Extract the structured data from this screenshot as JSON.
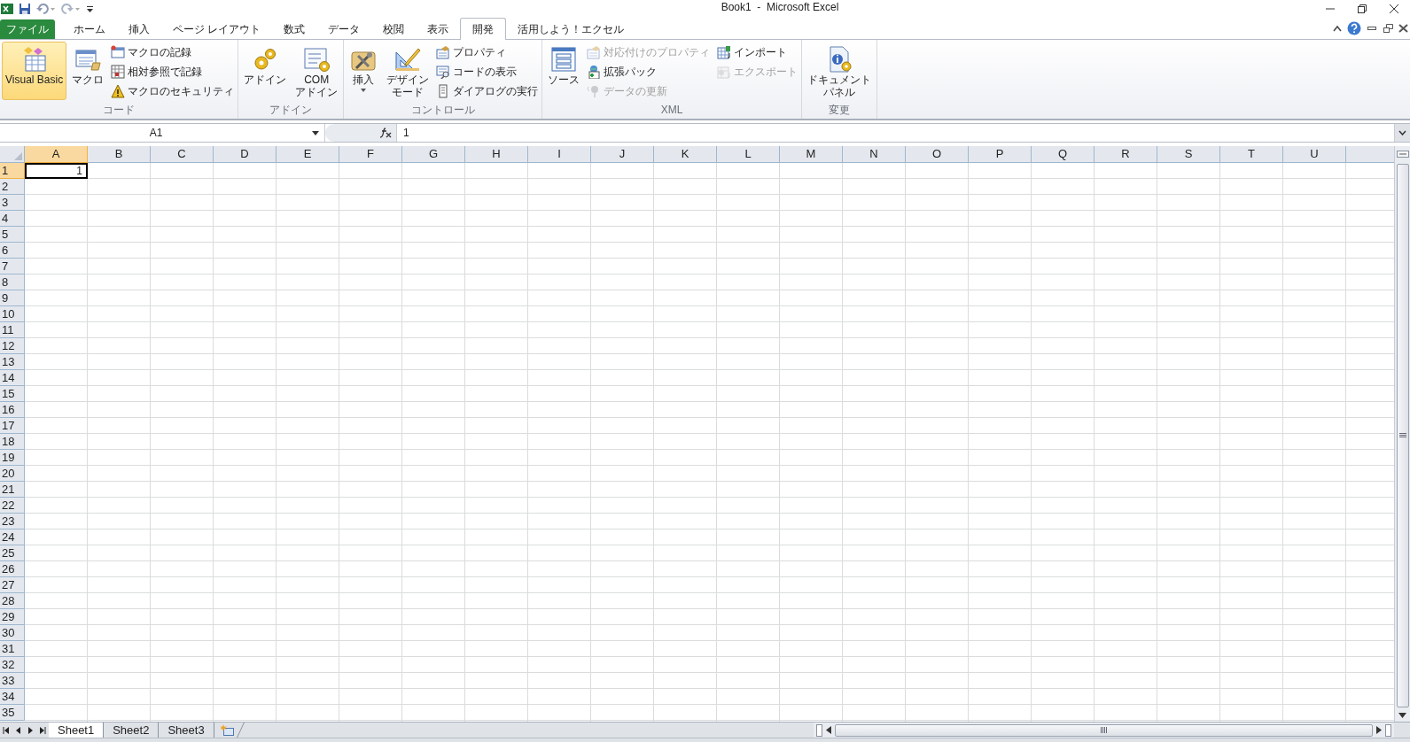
{
  "window": {
    "title": "Book1  -  Microsoft Excel"
  },
  "tabs": [
    {
      "label": "ファイル",
      "kind": "file",
      "selected": false
    },
    {
      "label": "ホーム",
      "kind": "tab",
      "selected": false
    },
    {
      "label": "挿入",
      "kind": "tab",
      "selected": false
    },
    {
      "label": "ページ レイアウト",
      "kind": "tab",
      "selected": false
    },
    {
      "label": "数式",
      "kind": "tab",
      "selected": false
    },
    {
      "label": "データ",
      "kind": "tab",
      "selected": false
    },
    {
      "label": "校閲",
      "kind": "tab",
      "selected": false
    },
    {
      "label": "表示",
      "kind": "tab",
      "selected": false
    },
    {
      "label": "開発",
      "kind": "tab",
      "selected": true
    },
    {
      "label": "活用しよう！エクセル",
      "kind": "tab",
      "selected": false
    }
  ],
  "ribbon": {
    "groups": [
      {
        "title": "コード",
        "large": [
          {
            "lines": [
              "Visual Basic"
            ],
            "highlighted": true
          },
          {
            "lines": [
              "マクロ"
            ],
            "highlighted": false
          }
        ],
        "small": [
          {
            "label": "マクロの記録",
            "disabled": false
          },
          {
            "label": "相対参照で記録",
            "disabled": false
          },
          {
            "label": "マクロのセキュリティ",
            "disabled": false
          }
        ]
      },
      {
        "title": "アドイン",
        "large": [
          {
            "lines": [
              "アドイン"
            ],
            "highlighted": false
          },
          {
            "lines": [
              "COM",
              "アドイン"
            ],
            "highlighted": false
          }
        ]
      },
      {
        "title": "コントロール",
        "large": [
          {
            "lines": [
              "挿入"
            ],
            "highlighted": false,
            "dropdown": true
          },
          {
            "lines": [
              "デザイン",
              "モード"
            ],
            "highlighted": false
          }
        ],
        "small": [
          {
            "label": "プロパティ",
            "disabled": false
          },
          {
            "label": "コードの表示",
            "disabled": false
          },
          {
            "label": "ダイアログの実行",
            "disabled": false
          }
        ]
      },
      {
        "title": "XML",
        "large": [
          {
            "lines": [
              "ソース"
            ],
            "highlighted": false
          }
        ],
        "small": [
          {
            "label": "対応付けのプロパティ",
            "disabled": true
          },
          {
            "label": "拡張パック",
            "disabled": false
          },
          {
            "label": "データの更新",
            "disabled": true
          },
          {
            "label": "インポート",
            "disabled": false
          },
          {
            "label": "エクスポート",
            "disabled": true
          }
        ]
      },
      {
        "title": "変更",
        "large": [
          {
            "lines": [
              "ドキュメント",
              "パネル"
            ],
            "highlighted": false
          }
        ]
      }
    ]
  },
  "formula_bar": {
    "name_box": "A1",
    "formula": "1"
  },
  "sheet": {
    "columns": [
      "A",
      "B",
      "C",
      "D",
      "E",
      "F",
      "G",
      "H",
      "I",
      "J",
      "K",
      "L",
      "M",
      "N",
      "O",
      "P",
      "Q",
      "R",
      "S",
      "T",
      "U"
    ],
    "rows": [
      {
        "header": "1",
        "cells": [
          {
            "value": "1",
            "selected": true
          }
        ]
      },
      {
        "header": "2"
      },
      {
        "header": "3"
      },
      {
        "header": "4"
      },
      {
        "header": "5"
      },
      {
        "header": "6"
      },
      {
        "header": "7"
      },
      {
        "header": "8"
      },
      {
        "header": "9"
      },
      {
        "header": "10"
      },
      {
        "header": "11"
      },
      {
        "header": "12"
      },
      {
        "header": "13"
      },
      {
        "header": "14"
      },
      {
        "header": "15"
      },
      {
        "header": "16"
      },
      {
        "header": "17"
      },
      {
        "header": "18"
      },
      {
        "header": "19"
      },
      {
        "header": "20"
      },
      {
        "header": "21"
      },
      {
        "header": "22"
      },
      {
        "header": "23"
      },
      {
        "header": "24"
      },
      {
        "header": "25"
      },
      {
        "header": "26"
      },
      {
        "header": "27"
      },
      {
        "header": "28"
      },
      {
        "header": "29"
      },
      {
        "header": "30"
      },
      {
        "header": "31"
      },
      {
        "header": "32"
      },
      {
        "header": "33"
      },
      {
        "header": "34"
      },
      {
        "header": "35"
      }
    ]
  },
  "sheet_tabs": [
    {
      "label": "Sheet1",
      "selected": true
    },
    {
      "label": "Sheet2",
      "selected": false
    },
    {
      "label": "Sheet3",
      "selected": false
    }
  ]
}
